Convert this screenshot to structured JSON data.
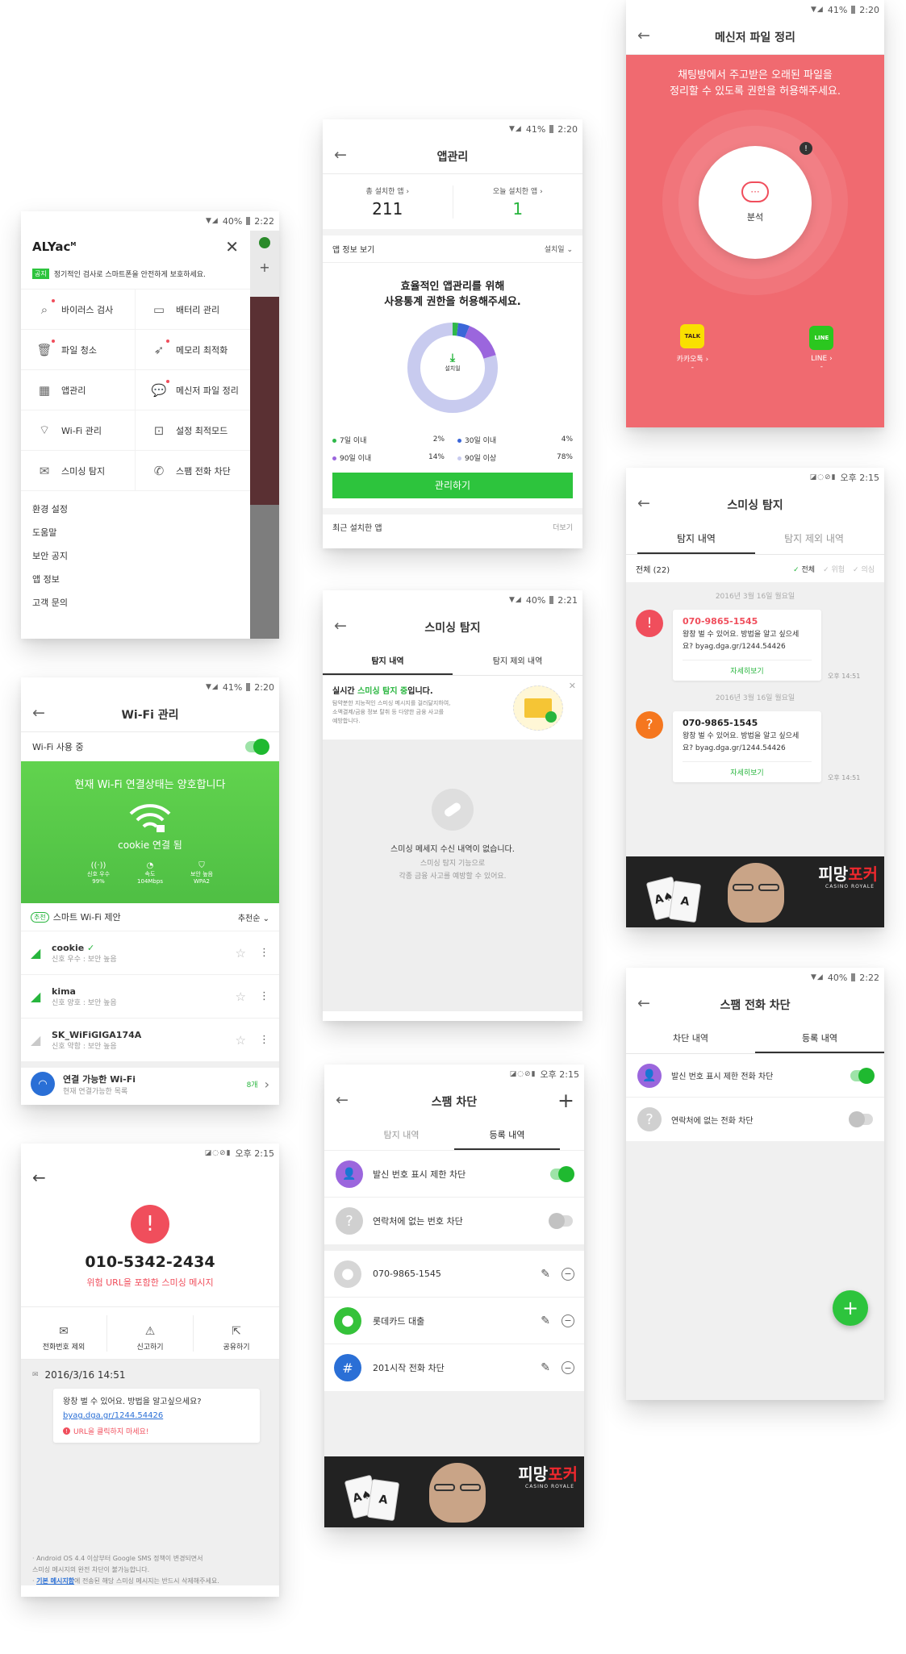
{
  "alyac": {
    "status": {
      "battery": "40%",
      "time": "2:22"
    },
    "logo": "ALYac",
    "logo_sup": "M",
    "notice_badge": "공지",
    "notice": "정기적인 검사로 스마트폰을 안전하게 보호하세요.",
    "menu": [
      {
        "label": "바이러스 검사",
        "icon": "search-icon"
      },
      {
        "label": "배터리 관리",
        "icon": "battery-icon"
      },
      {
        "label": "파일 청소",
        "icon": "trash-icon"
      },
      {
        "label": "메모리 최적화",
        "icon": "rocket-icon"
      },
      {
        "label": "앱관리",
        "icon": "apps-icon"
      },
      {
        "label": "메신저 파일 정리",
        "icon": "chat-icon"
      },
      {
        "label": "Wi-Fi 관리",
        "icon": "wifi-icon"
      },
      {
        "label": "설정 최적모드",
        "icon": "settings-mode-icon"
      },
      {
        "label": "스미싱 탐지",
        "icon": "mail-icon"
      },
      {
        "label": "스팸 전화 차단",
        "icon": "phone-block-icon"
      }
    ],
    "links": [
      "환경 설정",
      "도움말",
      "보안 공지",
      "앱 정보",
      "고객 문의"
    ]
  },
  "wifi": {
    "status": {
      "battery": "41%",
      "time": "2:20"
    },
    "title": "Wi-Fi 관리",
    "using_label": "Wi-Fi 사용 중",
    "hero_title": "현재 Wi-Fi 연결상태는 양호합니다",
    "connected": "cookie 연결 됨",
    "stats": [
      {
        "label": "신호 우수",
        "value": "99%",
        "icon": "signal-icon"
      },
      {
        "label": "속도",
        "value": "104Mbps",
        "icon": "speed-icon"
      },
      {
        "label": "보안 높음",
        "value": "WPA2",
        "icon": "shield-icon"
      }
    ],
    "rec_badge": "추천",
    "rec_title": "스마트 Wi-Fi 제안",
    "sort": "추천순",
    "networks": [
      {
        "name": "cookie",
        "detail": "신호 우수 : 보안 높음"
      },
      {
        "name": "kima",
        "detail": "신호 양호 : 보안 높음"
      },
      {
        "name": "SK_WiFiGIGA174A",
        "detail": "신호 약함 : 보안 높음"
      }
    ],
    "available_label": "연결 가능한 Wi-Fi",
    "available_sub": "현재 연결가능한 목록",
    "available_count": "8개",
    "colors": {
      "green": "#5cc84b",
      "accent": "#27b53d"
    }
  },
  "smsdetail": {
    "status": {
      "time": "오후 2:15"
    },
    "number": "010-5342-2434",
    "warning": "위험 URL을 포함한 스미싱 메시지",
    "actions": [
      {
        "label": "전화번호 제외",
        "icon": "mail-remove-icon"
      },
      {
        "label": "신고하기",
        "icon": "report-icon"
      },
      {
        "label": "공유하기",
        "icon": "share-icon"
      }
    ],
    "date": "2016/3/16 14:51",
    "message_pre": "왕창 벌 수 있어요. 방법을 알고싶으세요? ",
    "message_link": "byag.dga.gr/1244.54426",
    "url_warning": "URL을 클릭하지 마세요!",
    "footnote1": "· Android OS 4.4 이상부터 Google SMS 정책이 변경되면서",
    "footnote2": "스미싱 메시지의 완전 차단이 불가능합니다.",
    "footnote3_link": "기본 메시지함",
    "footnote3_rest": "에 전송된 해당 스미싱 메시지는 반드시 삭제해주세요."
  },
  "appmgr": {
    "status": {
      "battery": "41%",
      "time": "2:20"
    },
    "title": "앱관리",
    "total_label": "총 설치한 앱",
    "total_value": "211",
    "today_label": "오늘 설치한 앱",
    "today_value": "1",
    "info_label": "앱 정보 보기",
    "sort": "설치일",
    "heading1": "효율적인 앱관리를 위해",
    "heading2": "사용통계 권한을 허용해주세요.",
    "donut_label": "설치일",
    "legend": [
      {
        "label": "7일 이내",
        "value": "2%",
        "color": "#2fb84a"
      },
      {
        "label": "30일 이내",
        "value": "4%",
        "color": "#3b66d8"
      },
      {
        "label": "90일 이내",
        "value": "14%",
        "color": "#9b66dd"
      },
      {
        "label": "90일 이상",
        "value": "78%",
        "color": "#c8cbef"
      }
    ],
    "manage_button": "관리하기",
    "recent_label": "최근 설치한 앱",
    "more": "더보기"
  },
  "smishing1": {
    "status": {
      "battery": "40%",
      "time": "2:21"
    },
    "title": "스미싱 탐지",
    "tabs": [
      "탐지 내역",
      "탐지 제외 내역"
    ],
    "realtime_pre": "실시간 ",
    "realtime_green": "스미싱 탐지 중",
    "realtime_post": "입니다.",
    "desc1": "탐약분한 지능적인 스미싱 메시지를 걸러달지하여,",
    "desc2": "소액결제/금융 정보 탈취 등 다양한 금융 사고를",
    "desc3": "예방합니다.",
    "empty1": "스미싱 메세지 수신 내역이 없습니다.",
    "empty2": "스미싱 탐지 기능으로",
    "empty3": "각종 금융 사고를 예방할 수 있어요."
  },
  "spam": {
    "status": {
      "time": "오후 2:15"
    },
    "title": "스팸 차단",
    "tabs": [
      "탐지 내역",
      "등록 내역"
    ],
    "toggles": [
      {
        "label": "발신 번호 표시 제한 차단",
        "on": true
      },
      {
        "label": "연락처에 없는 번호 차단",
        "on": false
      }
    ],
    "entries": [
      {
        "label": "070-9865-1545",
        "icon": "person-icon",
        "color": "#d6d6d6"
      },
      {
        "label": "롯데카드 대출",
        "icon": "person-icon",
        "color": "#35c23a"
      },
      {
        "label": "201시작 전화 차단",
        "icon": "hash-icon",
        "color": "#2a6fd6"
      }
    ]
  },
  "messenger": {
    "status": {
      "battery": "41%",
      "time": "2:20"
    },
    "title": "메신저 파일 정리",
    "desc1": "채팅방에서 주고받은 오래된 파일을",
    "desc2": "정리할 수 있도록 권한을 허용해주세요.",
    "analyze": "분석",
    "apps": [
      {
        "label": "카카오톡",
        "sub": "-",
        "icon": "kakaotalk-icon",
        "badge": "TALK"
      },
      {
        "label": "LINE",
        "sub": "-",
        "icon": "line-icon",
        "badge": "LINE"
      }
    ],
    "colors": {
      "bg": "#f06a70"
    }
  },
  "smishing2": {
    "status": {
      "time": "오후 2:15"
    },
    "title": "스미싱 탐지",
    "tabs": [
      "탐지 내역",
      "탐지 제외 내역"
    ],
    "filter_label": "전체 (22)",
    "filters": [
      "전체",
      "위험",
      "의심"
    ],
    "items": [
      {
        "date": "2016년 3월 16일 월요일",
        "number": "070-9865-1545",
        "text1": "왕창 벌 수 있어요. 방법을 알고 싶으세",
        "text2": "요? byag.dga.gr/1244.54426",
        "more": "자세히보기",
        "time": "오후 14:51",
        "icon": "!"
      },
      {
        "date": "2016년 3월 16일 월요일",
        "number": "070-9865-1545",
        "text1": "왕창 벌 수 있어요. 방법을 알고 싶으세",
        "text2": "요? byag.dga.gr/1244.54426",
        "more": "자세히보기",
        "time": "오후 14:51",
        "icon": "?"
      }
    ]
  },
  "spamcall": {
    "status": {
      "battery": "40%",
      "time": "2:22"
    },
    "title": "스팸 전화 차단",
    "tabs": [
      "차단 내역",
      "등록 내역"
    ],
    "toggles": [
      {
        "label": "발신 번호 표시 제한 전화 차단",
        "on": true
      },
      {
        "label": "연락처에 없는 전화 차단",
        "on": false
      }
    ]
  },
  "ad": {
    "title_prefix": "피망",
    "title_main": "포커",
    "subtitle": "CASINO ROYALE"
  }
}
